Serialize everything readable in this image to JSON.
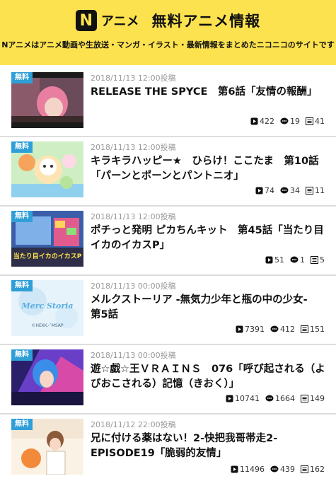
{
  "header": {
    "logo_letter": "N",
    "brand_name": "アニメ",
    "title": "無料アニメ情報",
    "tagline": "Nアニメはアニメ動画や生放送・マンガ・イラスト・最新情報をまとめたニコニコのサイトです",
    "bg_color": "#fde24f"
  },
  "badge_label": "無料",
  "items": [
    {
      "date": "2018/11/13 12:00投稿",
      "title": "RELEASE THE SPYCE　第6話「友情の報酬」",
      "views": "422",
      "comments": "19",
      "mylists": "41"
    },
    {
      "date": "2018/11/13 12:00投稿",
      "title": "キラキラハッピー★　ひらけ！ここたま　第10話「パーンとポーンとパントニオ」",
      "views": "74",
      "comments": "34",
      "mylists": "11"
    },
    {
      "date": "2018/11/13 12:00投稿",
      "title": "ポチっと発明 ピカちんキット　第45話「当たり目イカのイカスP」",
      "views": "51",
      "comments": "1",
      "mylists": "5"
    },
    {
      "date": "2018/11/13 00:00投稿",
      "title": "メルクストーリア -無気力少年と瓶の中の少女-　第5話",
      "views": "7391",
      "comments": "412",
      "mylists": "151"
    },
    {
      "date": "2018/11/13 00:00投稿",
      "title": "遊☆戯☆王ＶＲＡＩＮＳ　076「呼び起される（よびおこされる）記憶（きおく）」",
      "views": "10741",
      "comments": "1664",
      "mylists": "149"
    },
    {
      "date": "2018/11/12 22:00投稿",
      "title": "兄に付ける薬はない！2-快把我哥帯走2- EPISODE19「脆弱的友情」",
      "views": "11496",
      "comments": "439",
      "mylists": "162"
    }
  ],
  "thumb_texts": {
    "item3": "当たり目イカのイカスP",
    "item4_logo": "Merc Storia",
    "item4_credit": "©HEKK／MSAP"
  }
}
